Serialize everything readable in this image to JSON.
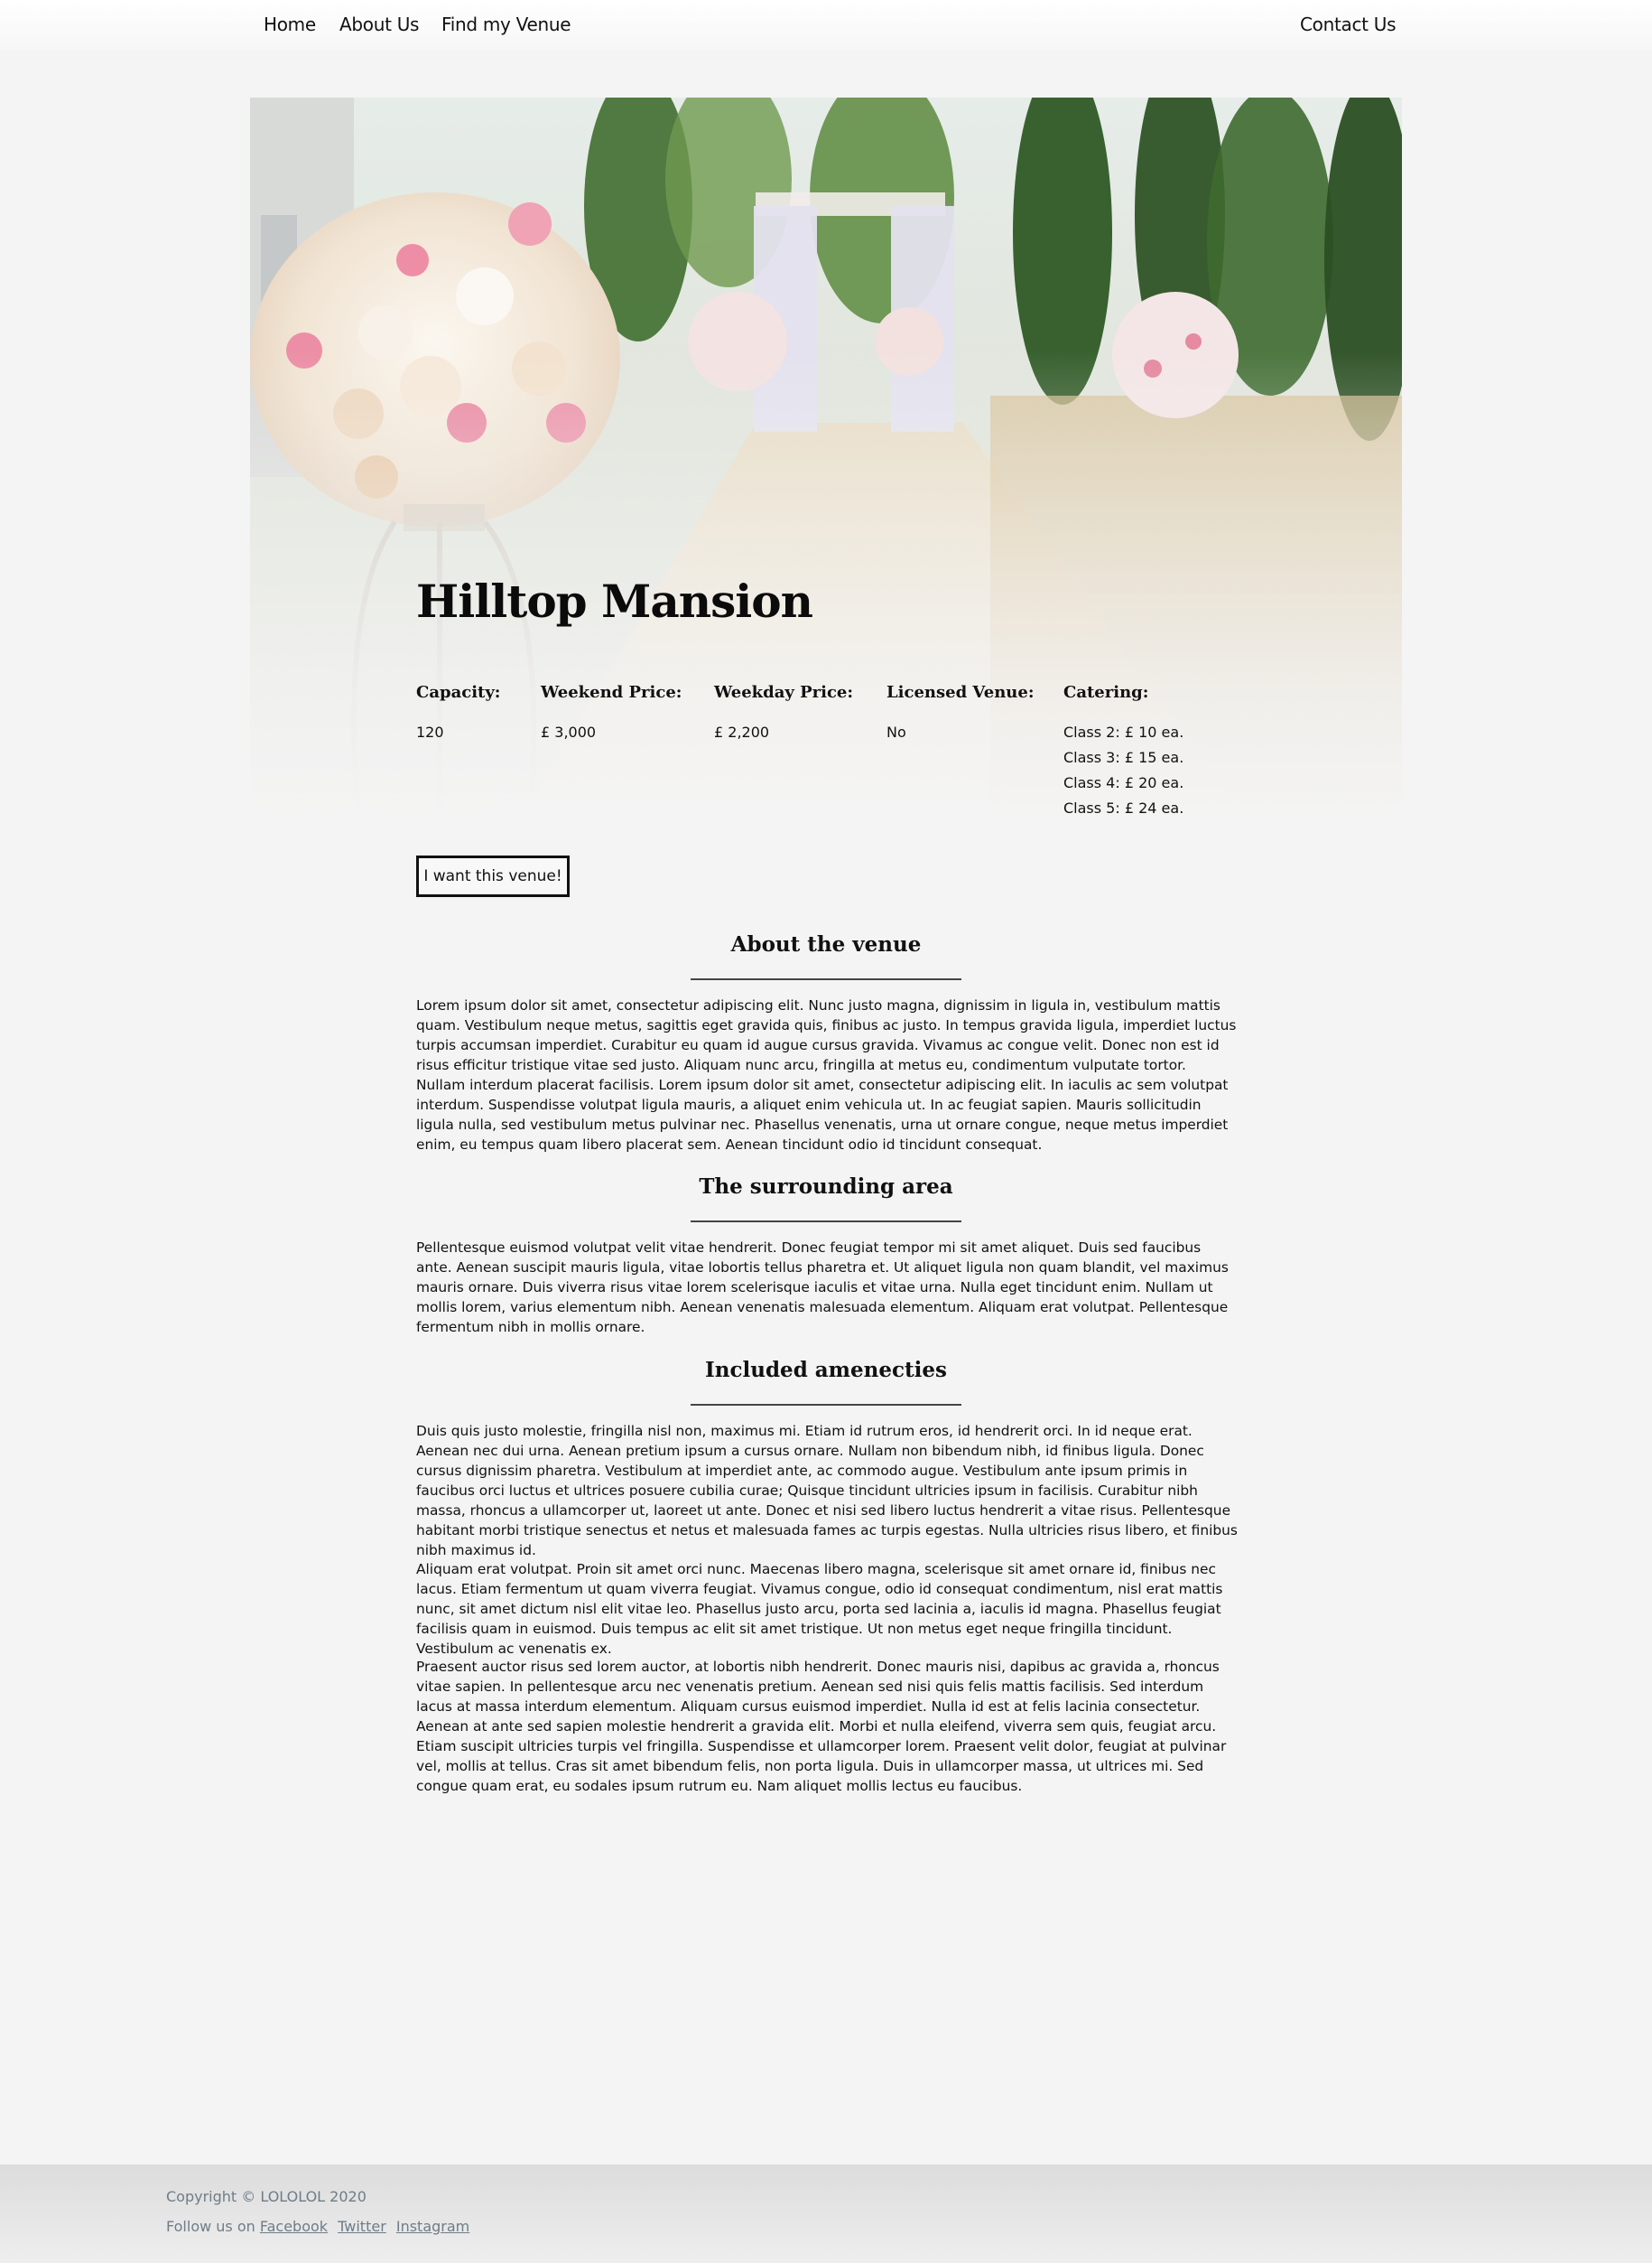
{
  "nav": {
    "home": "Home",
    "about": "About Us",
    "find": "Find my Venue",
    "contact": "Contact Us"
  },
  "venue": {
    "title": "Hilltop Mansion",
    "capacity_label": "Capacity:",
    "capacity": "120",
    "weekend_label": "Weekend Price:",
    "weekend": "£ 3,000",
    "weekday_label": "Weekday Price:",
    "weekday": "£ 2,200",
    "licensed_label": "Licensed Venue:",
    "licensed": "No",
    "catering_label": "Catering:",
    "catering": [
      "Class 2: £ 10 ea.",
      "Class 3: £ 15 ea.",
      "Class 4: £ 20 ea.",
      "Class 5: £ 24 ea."
    ],
    "button": "I want this venue!"
  },
  "sections": {
    "about_title": "About the venue",
    "about_text": "Lorem ipsum dolor sit amet, consectetur adipiscing elit. Nunc justo magna, dignissim in ligula in, vestibulum mattis quam. Vestibulum neque metus, sagittis eget gravida quis, finibus ac justo. In tempus gravida ligula, imperdiet luctus turpis accumsan imperdiet. Curabitur eu quam id augue cursus gravida. Vivamus ac congue velit. Donec non est id risus efficitur tristique vitae sed justo. Aliquam nunc arcu, fringilla at metus eu, condimentum vulputate tortor. Nullam interdum placerat facilisis. Lorem ipsum dolor sit amet, consectetur adipiscing elit. In iaculis ac sem volutpat interdum. Suspendisse volutpat ligula mauris, a aliquet enim vehicula ut. In ac feugiat sapien. Mauris sollicitudin ligula nulla, sed vestibulum metus pulvinar nec. Phasellus venenatis, urna ut ornare congue, neque metus imperdiet enim, eu tempus quam libero placerat sem. Aenean tincidunt odio id tincidunt consequat.",
    "area_title": "The surrounding area",
    "area_text": "Pellentesque euismod volutpat velit vitae hendrerit. Donec feugiat tempor mi sit amet aliquet. Duis sed faucibus ante. Aenean suscipit mauris ligula, vitae lobortis tellus pharetra et. Ut aliquet ligula non quam blandit, vel maximus mauris ornare. Duis viverra risus vitae lorem scelerisque iaculis et vitae urna. Nulla eget tincidunt enim. Nullam ut mollis lorem, varius elementum nibh. Aenean venenatis malesuada elementum. Aliquam erat volutpat. Pellentesque fermentum nibh in mollis ornare.",
    "amen_title": "Included amenecties",
    "amen_text_1": "Duis quis justo molestie, fringilla nisl non, maximus mi. Etiam id rutrum eros, id hendrerit orci. In id neque erat. Aenean nec dui urna. Aenean pretium ipsum a cursus ornare. Nullam non bibendum nibh, id finibus ligula. Donec cursus dignissim pharetra. Vestibulum at imperdiet ante, ac commodo augue. Vestibulum ante ipsum primis in faucibus orci luctus et ultrices posuere cubilia curae; Quisque tincidunt ultricies ipsum in facilisis. Curabitur nibh massa, rhoncus a ullamcorper ut, laoreet ut ante. Donec et nisi sed libero luctus hendrerit a vitae risus. Pellentesque habitant morbi tristique senectus et netus et malesuada fames ac turpis egestas. Nulla ultricies risus libero, et finibus nibh maximus id.",
    "amen_text_2": "Aliquam erat volutpat. Proin sit amet orci nunc. Maecenas libero magna, scelerisque sit amet ornare id, finibus nec lacus. Etiam fermentum ut quam viverra feugiat. Vivamus congue, odio id consequat condimentum, nisl erat mattis nunc, sit amet dictum nisl elit vitae leo. Phasellus justo arcu, porta sed lacinia a, iaculis id magna. Phasellus feugiat facilisis quam in euismod. Duis tempus ac elit sit amet tristique. Ut non metus eget neque fringilla tincidunt. Vestibulum ac venenatis ex.",
    "amen_text_3": "Praesent auctor risus sed lorem auctor, at lobortis nibh hendrerit. Donec mauris nisi, dapibus ac gravida a, rhoncus vitae sapien. In pellentesque arcu nec venenatis pretium. Aenean sed nisi quis felis mattis facilisis. Sed interdum lacus at massa interdum elementum. Aliquam cursus euismod imperdiet. Nulla id est at felis lacinia consectetur. Aenean at ante sed sapien molestie hendrerit a gravida elit. Morbi et nulla eleifend, viverra sem quis, feugiat arcu. Etiam suscipit ultricies turpis vel fringilla. Suspendisse et ullamcorper lorem. Praesent velit dolor, feugiat at pulvinar vel, mollis at tellus. Cras sit amet bibendum felis, non porta ligula. Duis in ullamcorper massa, ut ultrices mi. Sed congue quam erat, eu sodales ipsum rutrum eu. Nam aliquet mollis lectus eu faucibus."
  },
  "footer": {
    "copyright": "Copyright © LOLOLOL 2020",
    "follow": "Follow us on",
    "facebook": "Facebook",
    "twitter": "Twitter",
    "instagram": "Instagram"
  }
}
